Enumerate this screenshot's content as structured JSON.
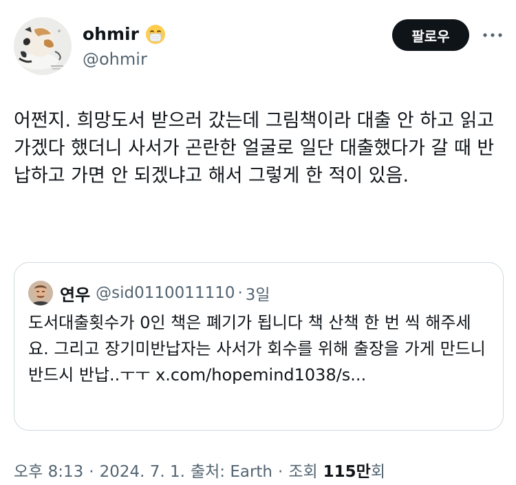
{
  "author": {
    "display_name": "ohmir",
    "handle": "@ohmir",
    "emoji": "face-with-medical-mask"
  },
  "actions": {
    "follow_label": "팔로우",
    "more_icon": "more-horizontal-icon"
  },
  "tweet": {
    "text": "어쩐지. 희망도서 받으러 갔는데 그림책이라 대출 안 하고 읽고 가겠다 했더니 사서가 곤란한 얼굴로 일단 대출했다가 갈 때 반납하고 가면 안 되겠냐고 해서 그렇게 한 적이 있음."
  },
  "quoted_tweet": {
    "display_name": "연우",
    "handle": "@sid0110011110",
    "separator": "·",
    "time": "3일",
    "text": "도서대출횟수가 0인 책은 폐기가 됩니다 책 산책 한 번 씩 해주세요. 그리고 장기미반납자는 사서가 회수를 위해 출장을 가게 만드니 반드시 반납..ㅜㅜ x.com/hopemind1038/s..."
  },
  "meta": {
    "time": "오후 8:13",
    "date": "2024. 7. 1.",
    "source": "출처: Earth",
    "views_label": "조회",
    "views_number": "115만",
    "views_suffix": "회",
    "dot": "·"
  },
  "colors": {
    "text_primary": "#0f1419",
    "text_secondary": "#536471",
    "border": "#cfd9de",
    "button_bg": "#0f1419"
  }
}
